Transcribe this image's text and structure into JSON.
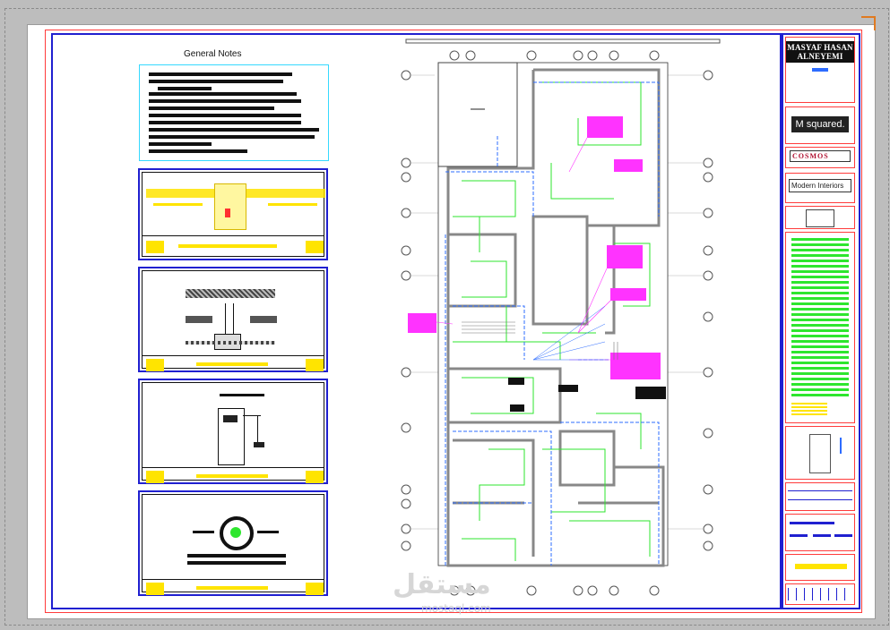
{
  "drawing": {
    "notes_title": "General Notes",
    "client_name": "MASYAF HASAN ALNEYEMI",
    "logo_msquared": "M squared.",
    "logo_cosmos": "COSMOS",
    "logo_modern": "Modern Interiors"
  },
  "watermark": {
    "text": "مستقل",
    "sub": "mostaql.com"
  },
  "colors": {
    "sheet": "#ffffff",
    "frame_blue": "#2020d0",
    "frame_red": "#ff3b3b",
    "wiring_green": "#2ee62e",
    "wiring_blue": "#2d6cff",
    "callout_magenta": "#ff33ff",
    "highlight_yellow": "#ffe400",
    "notes_cyan": "#35d9ff"
  }
}
